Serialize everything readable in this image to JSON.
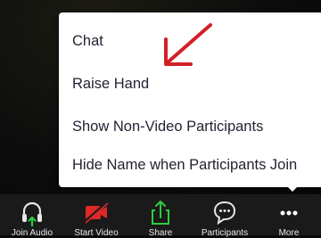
{
  "more_menu": {
    "items": [
      {
        "label": "Chat"
      },
      {
        "label": "Raise Hand"
      },
      {
        "label": "Show Non-Video Participants"
      },
      {
        "label": "Hide Name when Participants Join"
      }
    ]
  },
  "toolbar": {
    "buttons": [
      {
        "label": "Join Audio",
        "icon": "headphones-icon"
      },
      {
        "label": "Start Video",
        "icon": "video-off-icon"
      },
      {
        "label": "Share",
        "icon": "share-icon"
      },
      {
        "label": "Participants",
        "icon": "chat-bubble-icon"
      },
      {
        "label": "More",
        "icon": "more-icon"
      }
    ]
  },
  "colors": {
    "menu_text": "#232333",
    "annotation_arrow": "#d21f26",
    "video_off": "#e02828",
    "share_green": "#2ecc40",
    "toolbar_bg": "#1a1a1a"
  }
}
